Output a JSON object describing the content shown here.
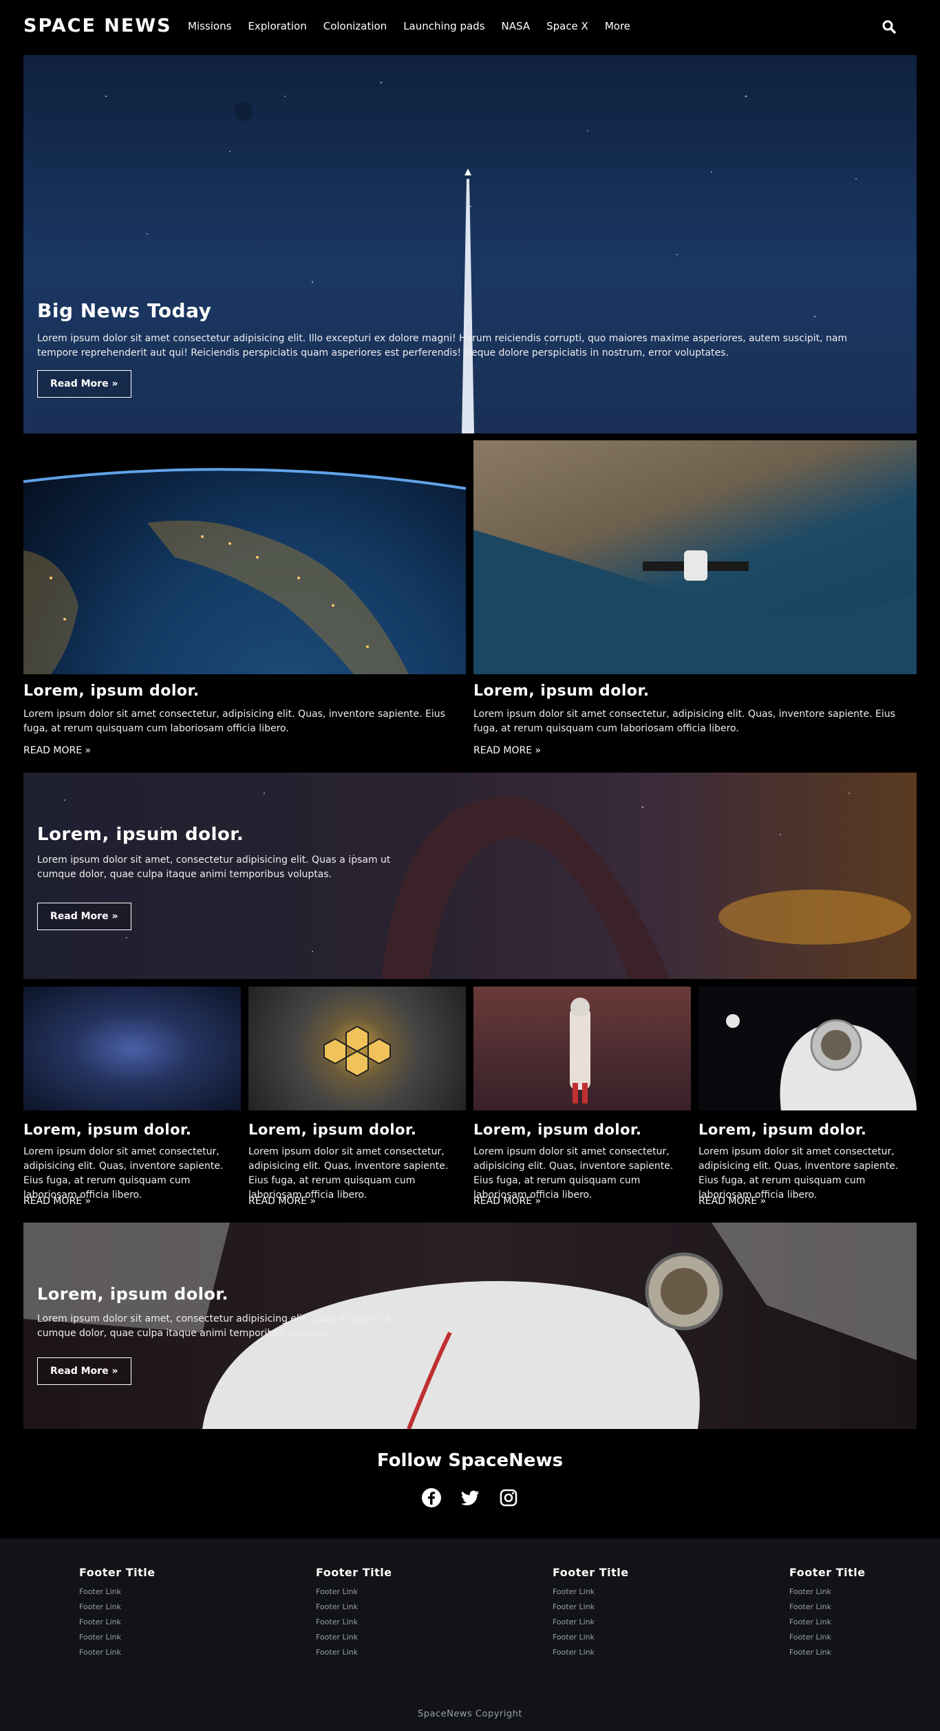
{
  "brand": {
    "logo": "SPACE NEWS"
  },
  "nav": {
    "items": [
      "Missions",
      "Exploration",
      "Colonization",
      "Launching pads",
      "NASA",
      "Space X",
      "More"
    ]
  },
  "hero": {
    "title": "Big News Today",
    "text": "Lorem ipsum dolor sit amet consectetur adipisicing elit. Illo excepturi ex dolore magni! Harum reiciendis corrupti, quo maiores maxime asperiores, autem suscipit, nam tempore reprehenderit aut qui! Reiciendis perspiciatis quam asperiores est perferendis! Neque dolore perspiciatis in nostrum, error voluptates.",
    "button": "Read More »"
  },
  "cards_row1": [
    {
      "title": "Lorem, ipsum dolor.",
      "text": "Lorem ipsum dolor sit amet consectetur, adipisicing elit. Quas, inventore sapiente. Eius fuga, at rerum quisquam cum laboriosam officia libero.",
      "more": "READ MORE »"
    },
    {
      "title": "Lorem, ipsum dolor.",
      "text": "Lorem ipsum dolor sit amet consectetur, adipisicing elit. Quas, inventore sapiente. Eius fuga, at rerum quisquam cum laboriosam officia libero.",
      "more": "READ MORE »"
    }
  ],
  "banner2": {
    "title": "Lorem, ipsum dolor.",
    "text": "Lorem ipsum dolor sit amet, consectetur adipisicing elit. Quas a ipsam ut cumque dolor, quae culpa itaque animi temporibus voluptas.",
    "button": "Read More »"
  },
  "cards_row2": [
    {
      "title": "Lorem, ipsum dolor.",
      "text": "Lorem ipsum dolor sit amet consectetur, adipisicing elit. Quas, inventore sapiente. Eius fuga, at rerum quisquam cum laboriosam officia libero.",
      "more": "READ MORE »"
    },
    {
      "title": "Lorem, ipsum dolor.",
      "text": "Lorem ipsum dolor sit amet consectetur, adipisicing elit. Quas, inventore sapiente. Eius fuga, at rerum quisquam cum laboriosam officia libero.",
      "more": "READ MORE »"
    },
    {
      "title": "Lorem, ipsum dolor.",
      "text": "Lorem ipsum dolor sit amet consectetur, adipisicing elit. Quas, inventore sapiente. Eius fuga, at rerum quisquam cum laboriosam officia libero.",
      "more": "READ MORE »"
    },
    {
      "title": "Lorem, ipsum dolor.",
      "text": "Lorem ipsum dolor sit amet consectetur, adipisicing elit. Quas, inventore sapiente. Eius fuga, at rerum quisquam cum laboriosam officia libero.",
      "more": "READ MORE »"
    }
  ],
  "banner3": {
    "title": "Lorem, ipsum dolor.",
    "text": "Lorem ipsum dolor sit amet, consectetur adipisicing elit. Quas a ipsam ut cumque dolor, quae culpa itaque animi temporibus voluptas.",
    "button": "Read More »"
  },
  "follow": {
    "title": "Follow SpaceNews",
    "icons": [
      "facebook-icon",
      "twitter-icon",
      "instagram-icon"
    ]
  },
  "footer": {
    "columns": [
      {
        "title": "Footer Title",
        "links": [
          "Footer Link",
          "Footer Link",
          "Footer Link",
          "Footer Link",
          "Footer Link"
        ]
      },
      {
        "title": "Footer Title",
        "links": [
          "Footer Link",
          "Footer Link",
          "Footer Link",
          "Footer Link",
          "Footer Link"
        ]
      },
      {
        "title": "Footer Title",
        "links": [
          "Footer Link",
          "Footer Link",
          "Footer Link",
          "Footer Link",
          "Footer Link"
        ]
      },
      {
        "title": "Footer Title",
        "links": [
          "Footer Link",
          "Footer Link",
          "Footer Link",
          "Footer Link",
          "Footer Link"
        ]
      }
    ],
    "copyright": "SpaceNews Copyright"
  },
  "colors": {
    "background": "#000000",
    "footer_bg": "#111316",
    "text": "#ffffff",
    "muted": "#9aa0a6"
  }
}
